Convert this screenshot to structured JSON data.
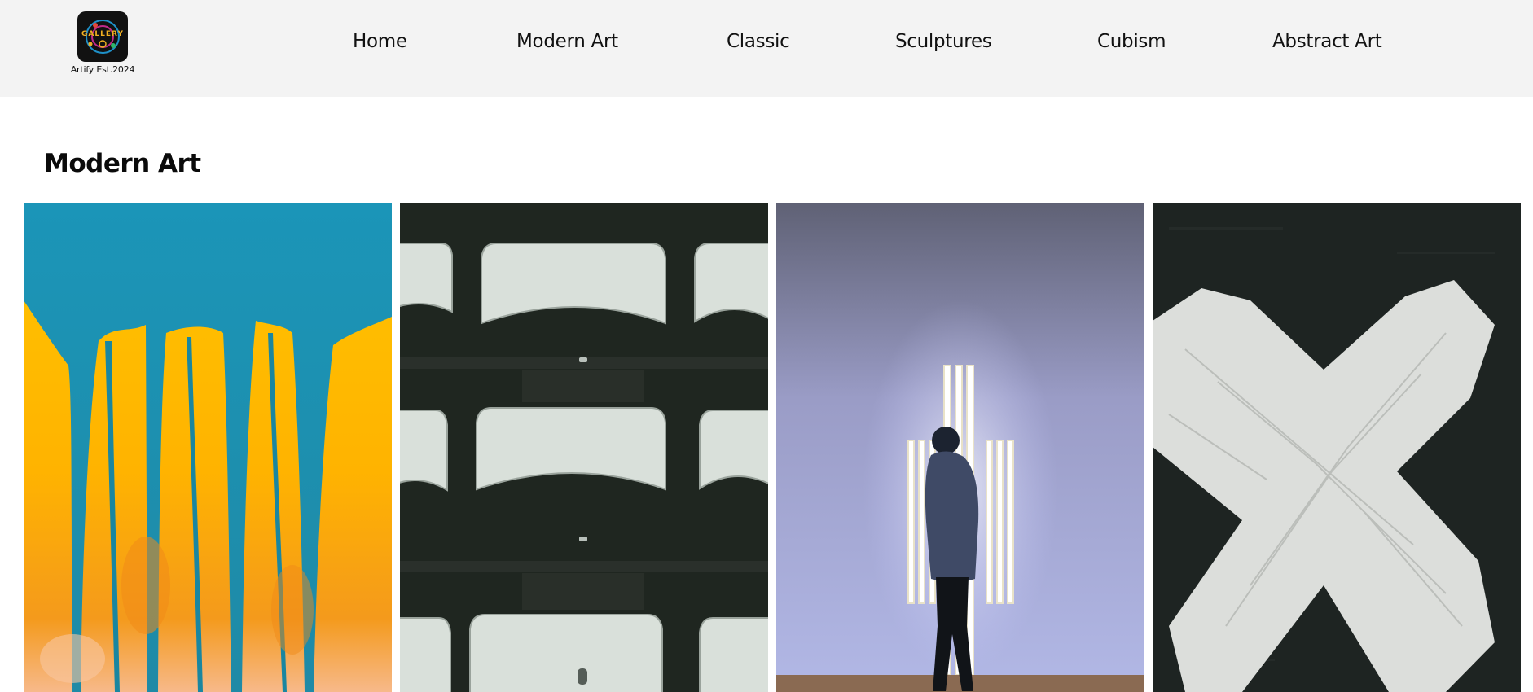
{
  "header": {
    "logo": {
      "badge_text": "GALLERY",
      "caption": "Artify Est.2024"
    },
    "nav": [
      {
        "label": "Home"
      },
      {
        "label": "Modern Art"
      },
      {
        "label": "Classic"
      },
      {
        "label": "Sculptures"
      },
      {
        "label": "Cubism"
      },
      {
        "label": "Abstract Art"
      }
    ]
  },
  "main": {
    "section_title": "Modern Art",
    "artworks": [
      {
        "image": "yellow-teal-paint-drip-image"
      },
      {
        "image": "stadium-seats-image"
      },
      {
        "image": "neon-cross-visitor-image"
      },
      {
        "image": "white-x-canvas-image"
      }
    ]
  },
  "colors": {
    "header_bg": "#f3f3f3",
    "page_bg": "#ffffff",
    "text": "#111111"
  }
}
